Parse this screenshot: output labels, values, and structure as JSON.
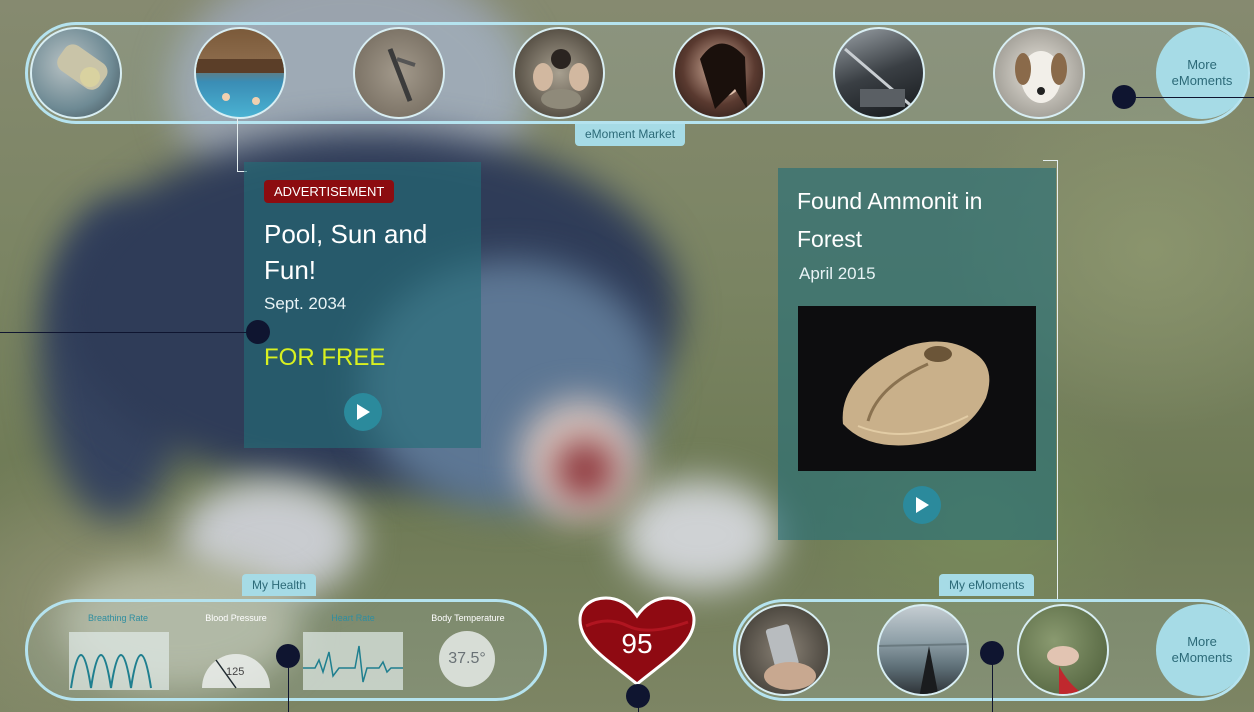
{
  "market": {
    "label": "eMoment Market",
    "more_label": "More eMoments",
    "thumbnails": [
      {
        "name": "market-thumb-1"
      },
      {
        "name": "market-thumb-2"
      },
      {
        "name": "market-thumb-3"
      },
      {
        "name": "market-thumb-4"
      },
      {
        "name": "market-thumb-5"
      },
      {
        "name": "market-thumb-6"
      },
      {
        "name": "market-thumb-7"
      }
    ]
  },
  "ad_card": {
    "badge": "ADVERTISEMENT",
    "title": "Pool, Sun and Fun!",
    "date": "Sept. 2034",
    "price": "FOR FREE"
  },
  "found_card": {
    "title": "Found Ammonit in Forest",
    "date": "April 2015"
  },
  "health": {
    "label": "My Health",
    "breathing_label": "Breathing Rate",
    "blood_pressure_label": "Blood Pressure",
    "heart_rate_label": "Heart Rate",
    "body_temp_label": "Body Temperature",
    "blood_pressure_value": "125",
    "blood_pressure_min": "",
    "blood_pressure_max": "",
    "body_temp_value": "37.5°",
    "heart_score": "95"
  },
  "moments": {
    "label": "My eMoments",
    "more_label": "More eMoments"
  },
  "colors": {
    "accent_light": "#a6dbe6",
    "card_bg": "#246e78",
    "ad_red": "#8c0c10",
    "price_yellow": "#d8f020",
    "heart_red": "#8f0a12"
  }
}
